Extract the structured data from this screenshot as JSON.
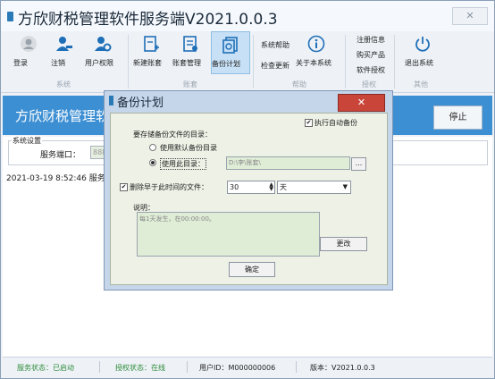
{
  "window": {
    "title": "方欣财税管理软件服务端V2021.0.0.3",
    "close": "✕"
  },
  "ribbon": {
    "groups": {
      "system": "系统",
      "account": "账套",
      "help": "帮助",
      "license": "授权",
      "other": "其他"
    },
    "buttons": {
      "login": "登录",
      "logout": "注销",
      "user_perm": "用户权限",
      "new_account": "新建账套",
      "account_mgmt": "账套管理",
      "backup_plan": "备份计划",
      "exit": "退出系统"
    },
    "small": {
      "help": "系统帮助",
      "check_update": "检查更新",
      "about": "关于本系统",
      "reg_info": "注册信息",
      "buy": "购买产品",
      "license": "软件授权"
    }
  },
  "banner": {
    "title": "方欣财税管理软",
    "stop_button": "停止"
  },
  "settings": {
    "title": "系统设置",
    "port_label": "服务端口：",
    "port_value": "888"
  },
  "log": {
    "line": "2021-03-19 8:52:46 服务"
  },
  "status": {
    "service": "服务状态：已启动",
    "license": "授权状态：在线",
    "user": "用户ID：M000000006",
    "version": "版本：V2021.0.0.3"
  },
  "dialog": {
    "title": "备份计划",
    "close": "✕",
    "auto_backup": "执行自动备份",
    "auto_backup_checked": true,
    "dir_label": "要存储备份文件的目录：",
    "opt_default": "使用默认备份目录",
    "opt_custom": "使用此目录：",
    "custom_path": "D:\\李\\账套\\",
    "browse": "...",
    "delete_label": "删除早于此时间的文件：",
    "delete_checked": true,
    "delete_value": "30",
    "delete_unit": "天",
    "desc_label": "说明：",
    "desc_text": "每1天发生，在00:00:00。",
    "change": "更改",
    "ok": "确定"
  }
}
